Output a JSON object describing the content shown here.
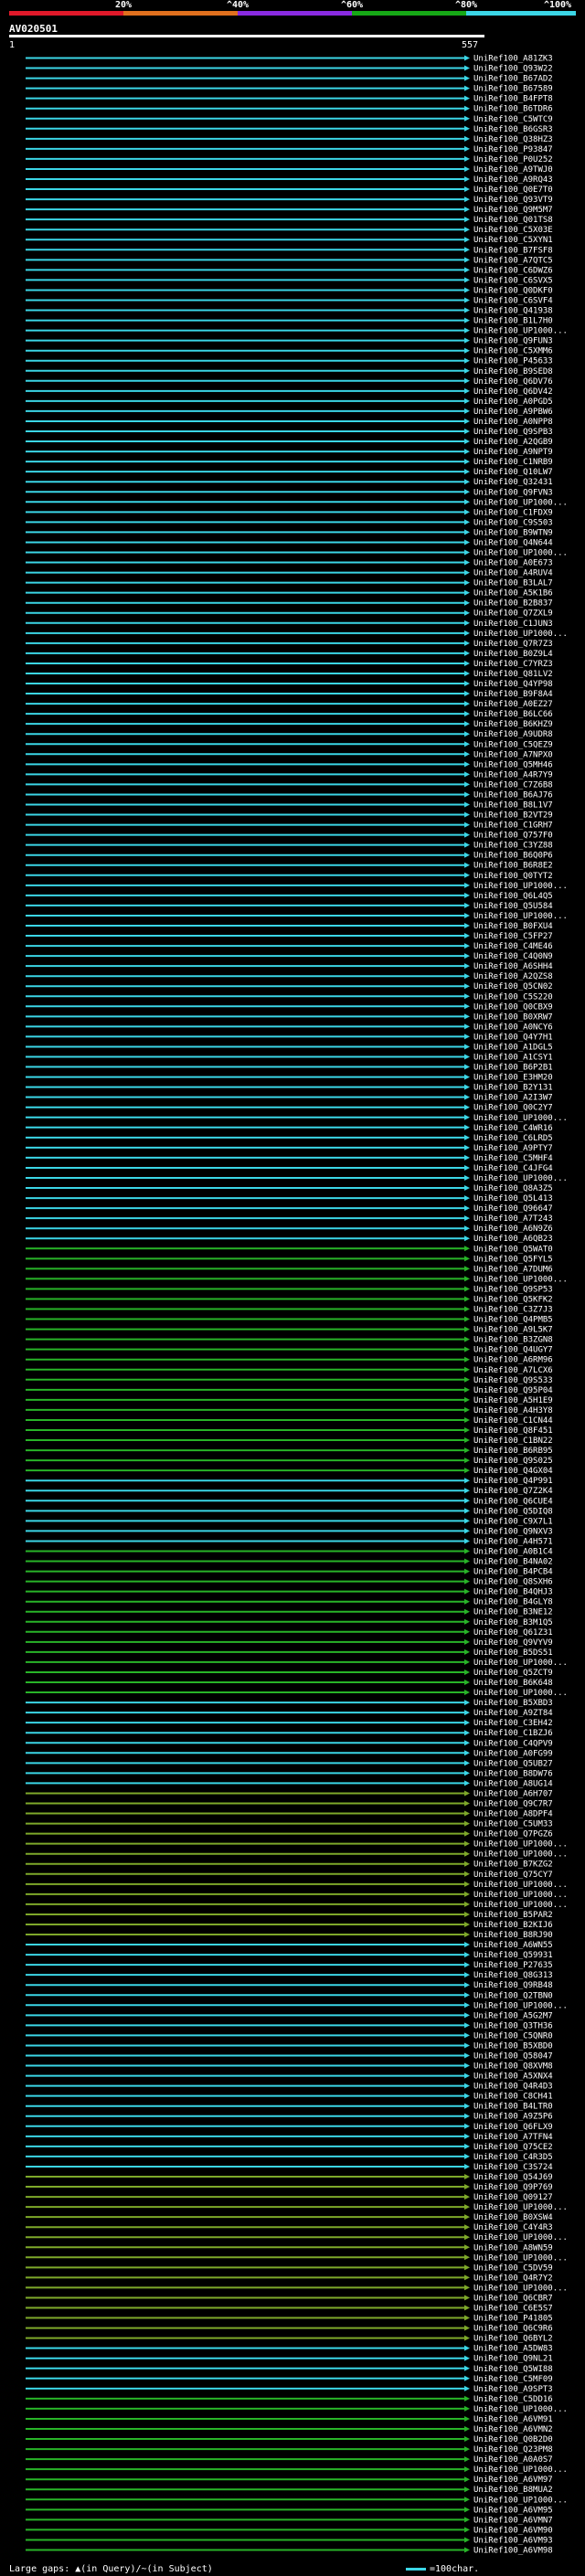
{
  "scale": {
    "ticks": [
      "20%",
      "^40%",
      "^60%",
      "^80%",
      "^100%"
    ],
    "colors": [
      "#e0192a",
      "#e0701e",
      "#8a2be2",
      "#16a816",
      "#3bd6e6"
    ]
  },
  "query": {
    "id": "AV020501",
    "start": "1",
    "end": "557"
  },
  "hits": {
    "colors": {
      "cyan": "#3bd6e6",
      "green": "#28b428",
      "olive": "#7ea82a",
      "gap": "#ffd000"
    },
    "labels": [
      "UniRef100_A81ZK3",
      "UniRef100_Q93W22",
      "UniRef100_B67AD2",
      "UniRef100_B67589",
      "UniRef100_B4FPT8",
      "UniRef100_B6TDR6",
      "UniRef100_C5WTC9",
      "UniRef100_B6GSR3",
      "UniRef100_Q38HZ3",
      "UniRef100_P93847",
      "UniRef100_P0U252",
      "UniRef100_A9TWJ0",
      "UniRef100_A9RQ43",
      "UniRef100_Q0E7T0",
      "UniRef100_Q93VT9",
      "UniRef100_Q9M5M7",
      "UniRef100_Q01TS8",
      "UniRef100_C5X03E",
      "UniRef100_C5XYN1",
      "UniRef100_B7FSF8",
      "UniRef100_A7QTC5",
      "UniRef100_C6DWZ6",
      "UniRef100_C6SVX5",
      "UniRef100_Q0DKF0",
      "UniRef100_C6SVF4",
      "UniRef100_Q41938",
      "UniRef100_B1L7H0",
      "UniRef100_UP1000...",
      "UniRef100_Q9FUN3",
      "UniRef100_C5XMM6",
      "UniRef100_P45633",
      "UniRef100_B9SED8",
      "UniRef100_Q6DV76",
      "UniRef100_Q6DV42",
      "UniRef100_A0PGD5",
      "UniRef100_A9PBW6",
      "UniRef100_A0NPP8",
      "UniRef100_Q9SPB3",
      "UniRef100_A2QGB9",
      "UniRef100_A9NPT9",
      "UniRef100_C1NRB9",
      "UniRef100_Q10LW7",
      "UniRef100_Q32431",
      "UniRef100_Q9FVN3",
      "UniRef100_UP1000...",
      "UniRef100_C1FDX9",
      "UniRef100_C9S503",
      "UniRef100_B9WTN9",
      "UniRef100_Q4N644",
      "UniRef100_UP1000...",
      "UniRef100_A0E673",
      "UniRef100_A4RUV4",
      "UniRef100_B3LAL7",
      "UniRef100_A5K1B6",
      "UniRef100_B2B837",
      "UniRef100_Q7ZXL9",
      "UniRef100_C1JUN3",
      "UniRef100_UP1000...",
      "UniRef100_Q7R7Z3",
      "UniRef100_B0Z9L4",
      "UniRef100_C7YRZ3",
      "UniRef100_Q81LV2",
      "UniRef100_Q4YP98",
      "UniRef100_B9F8A4",
      "UniRef100_A0EZ27",
      "UniRef100_B6LC66",
      "UniRef100_B6KHZ9",
      "UniRef100_A9UDR8",
      "UniRef100_C5QEZ9",
      "UniRef100_A7NPX0",
      "UniRef100_Q5MH46",
      "UniRef100_A4R7Y9",
      "UniRef100_C7Z6B8",
      "UniRef100_B6AJ76",
      "UniRef100_B8L1V7",
      "UniRef100_B2VT29",
      "UniRef100_C1GRH7",
      "UniRef100_Q757F0",
      "UniRef100_C3YZ88",
      "UniRef100_B6Q0P6",
      "UniRef100_B6R8E2",
      "UniRef100_Q0TYT2",
      "UniRef100_UP1000...",
      "UniRef100_Q6L4Q5",
      "UniRef100_Q5U584",
      "UniRef100_UP1000...",
      "UniRef100_B0FXU4",
      "UniRef100_C5FP27",
      "UniRef100_C4ME46",
      "UniRef100_C4Q0N9",
      "UniRef100_A6SHH4",
      "UniRef100_A2QZS8",
      "UniRef100_Q5CN02",
      "UniRef100_C5S220",
      "UniRef100_Q0CBX9",
      "UniRef100_B0XRW7",
      "UniRef100_A0NCY6",
      "UniRef100_Q4Y7H1",
      "UniRef100_A1DGL5",
      "UniRef100_A1CSY1",
      "UniRef100_B6P2B1",
      "UniRef100_E3HM20",
      "UniRef100_B2Y131",
      "UniRef100_A2I3W7",
      "UniRef100_Q0C2Y7",
      "UniRef100_UP1000...",
      "UniRef100_C4WR16",
      "UniRef100_C6LRD5",
      "UniRef100_A9PTY7",
      "UniRef100_C5MHF4",
      "UniRef100_C4JFG4",
      "UniRef100_UP1000...",
      "UniRef100_Q8A3Z5",
      "UniRef100_Q5L413",
      "UniRef100_Q96647",
      "UniRef100_A7T243",
      "UniRef100_A6N9Z6",
      "UniRef100_A6QB23",
      "UniRef100_Q5WAT0",
      "UniRef100_Q5FYL5",
      "UniRef100_A7DUM6",
      "UniRef100_UP1000...",
      "UniRef100_Q9SP53",
      "UniRef100_Q5KFK2",
      "UniRef100_C3Z7J3",
      "UniRef100_Q4PMB5",
      "UniRef100_A9L5K7",
      "UniRef100_B3ZGN8",
      "UniRef100_Q4UGY7",
      "UniRef100_A6RM96",
      "UniRef100_A7LCX6",
      "UniRef100_Q9S533",
      "UniRef100_Q95P04",
      "UniRef100_A5H1E9",
      "UniRef100_A4H3Y8",
      "UniRef100_C1CN44",
      "UniRef100_Q8F451",
      "UniRef100_C1BN22",
      "UniRef100_B6RB95",
      "UniRef100_Q9S025",
      "UniRef100_Q4GX04",
      "UniRef100_Q4P991",
      "UniRef100_Q7Z2K4",
      "UniRef100_Q6CUE4",
      "UniRef100_Q5DIQ8",
      "UniRef100_C9X7L1",
      "UniRef100_Q9NXV3",
      "UniRef100_A4H571",
      "UniRef100_A0B1C4",
      "UniRef100_B4NA02",
      "UniRef100_B4PCB4",
      "UniRef100_Q8SXH6",
      "UniRef100_B4QHJ3",
      "UniRef100_B4GLY8",
      "UniRef100_B3NE12",
      "UniRef100_B3M1Q5",
      "UniRef100_Q61Z31",
      "UniRef100_Q9VYV9",
      "UniRef100_B5DS51",
      "UniRef100_UP1000...",
      "UniRef100_Q5ZCT9",
      "UniRef100_B6K648",
      "UniRef100_UP1000...",
      "UniRef100_B5XBD3",
      "UniRef100_A9ZT84",
      "UniRef100_C3EH42",
      "UniRef100_C1BZJ6",
      "UniRef100_C4QPV9",
      "UniRef100_A0FG99",
      "UniRef100_Q5UB27",
      "UniRef100_B8DW76",
      "UniRef100_A8UG14",
      "UniRef100_A6H707",
      "UniRef100_Q9C7R7",
      "UniRef100_A8DPF4",
      "UniRef100_C5UM33",
      "UniRef100_Q7PGZ6",
      "UniRef100_UP1000...",
      "UniRef100_UP1000...",
      "UniRef100_B7KZG2",
      "UniRef100_Q75CY7",
      "UniRef100_UP1000...",
      "UniRef100_UP1000...",
      "UniRef100_UP1000...",
      "UniRef100_B5PAR2",
      "UniRef100_B2KIJ6",
      "UniRef100_B8RJ90",
      "UniRef100_A6WN55",
      "UniRef100_Q59931",
      "UniRef100_P27635",
      "UniRef100_Q8G313",
      "UniRef100_Q9RB48",
      "UniRef100_Q2TBN0",
      "UniRef100_UP1000...",
      "UniRef100_A5G2M7",
      "UniRef100_Q3TH36",
      "UniRef100_C5QNR0",
      "UniRef100_B5XBD0",
      "UniRef100_Q58047",
      "UniRef100_Q8XVM8",
      "UniRef100_A5XNX4",
      "UniRef100_Q4R4D3",
      "UniRef100_C8CH41",
      "UniRef100_B4LTR0",
      "UniRef100_A9Z5P6",
      "UniRef100_Q6FLX9",
      "UniRef100_A7TFN4",
      "UniRef100_Q75CE2",
      "UniRef100_C4R3D5",
      "UniRef100_C3S724",
      "UniRef100_Q54J69",
      "UniRef100_Q9P769",
      "UniRef100_Q09127",
      "UniRef100_UP1000...",
      "UniRef100_B0XSW4",
      "UniRef100_C4Y4R3",
      "UniRef100_UP1000...",
      "UniRef100_A8WN59",
      "UniRef100_UP1000...",
      "UniRef100_C5DV59",
      "UniRef100_Q4R7Y2",
      "UniRef100_UP1000...",
      "UniRef100_Q6CBR7",
      "UniRef100_C6E5S7",
      "UniRef100_P41805",
      "UniRef100_Q6C9R6",
      "UniRef100_Q6BYL2",
      "UniRef100_A5DW83",
      "UniRef100_Q9NL21",
      "UniRef100_Q5WI88",
      "UniRef100_C5MF09",
      "UniRef100_A9SPT3",
      "UniRef100_C5DD16",
      "UniRef100_UP1000...",
      "UniRef100_A6VM91",
      "UniRef100_A6VMN2",
      "UniRef100_Q0B2D0",
      "UniRef100_Q23PM8",
      "UniRef100_A0A0S7",
      "UniRef100_UP1000...",
      "UniRef100_A6VM97",
      "UniRef100_B8MUA2",
      "UniRef100_UP1000...",
      "UniRef100_A6VM95",
      "UniRef100_A6VMN7",
      "UniRef100_A6VM90",
      "UniRef100_A6VM93",
      "UniRef100_A6VM98"
    ]
  },
  "legend": {
    "text": "Large gaps: ▲(in Query)/~(in Subject)",
    "scale_note": "=100char."
  }
}
